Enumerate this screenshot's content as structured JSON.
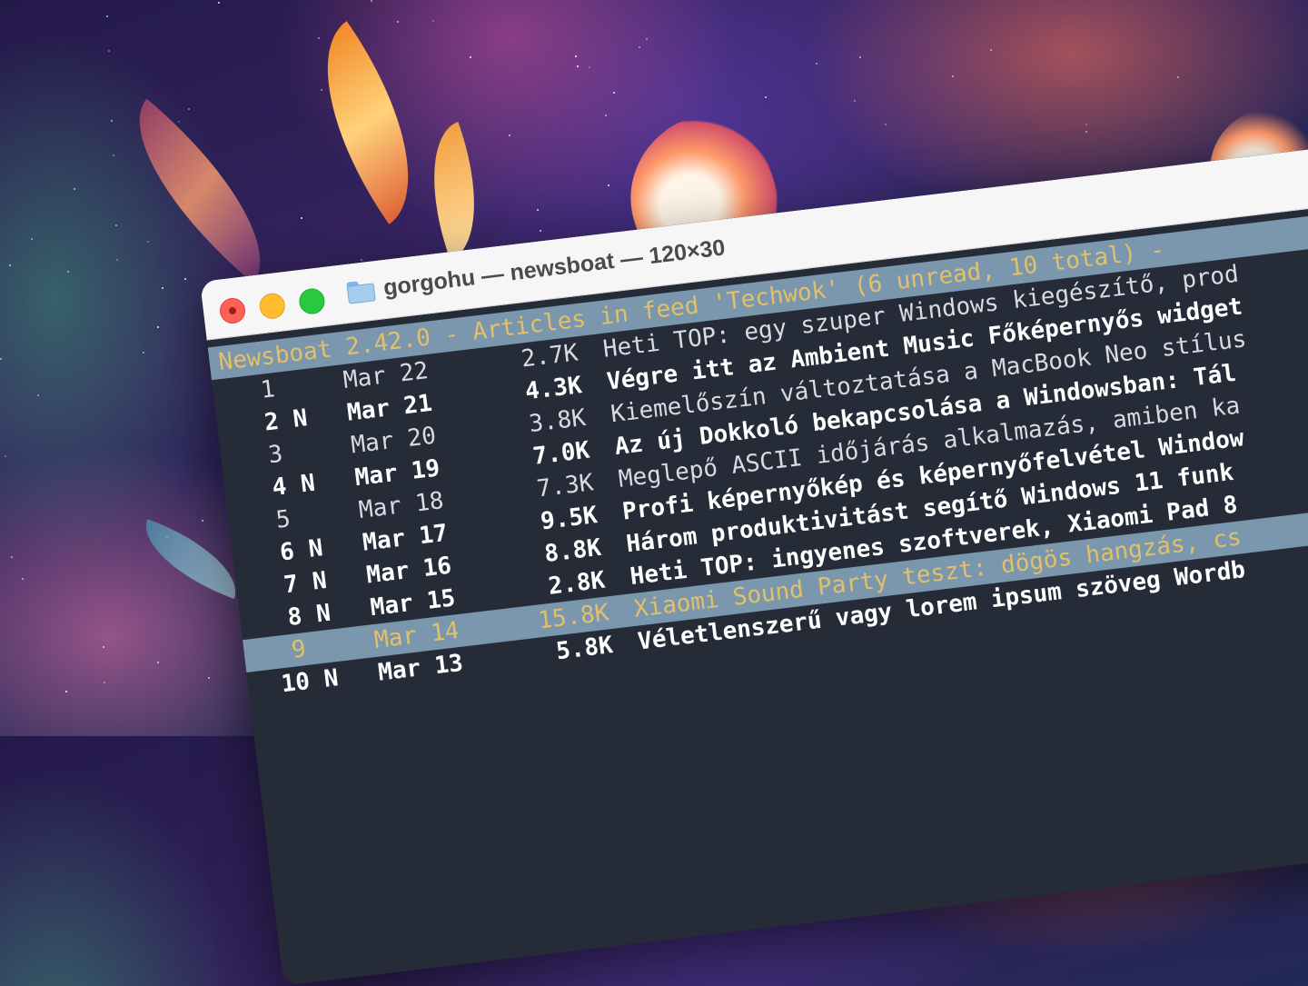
{
  "window": {
    "title": "gorgohu — newsboat — 120×30"
  },
  "header": "Newsboat 2.42.0 - Articles in feed 'Techwok' (6 unread, 10 total) - ",
  "articles": [
    {
      "idx": "1",
      "flag": "",
      "date": "Mar 22",
      "size": "2.7K",
      "title": "Heti TOP: egy szuper Windows kiegészítő, prod",
      "unread": false,
      "selected": false
    },
    {
      "idx": "2",
      "flag": "N",
      "date": "Mar 21",
      "size": "4.3K",
      "title": "Végre itt az Ambient Music Főképernyős widget",
      "unread": true,
      "selected": false
    },
    {
      "idx": "3",
      "flag": "",
      "date": "Mar 20",
      "size": "3.8K",
      "title": "Kiemelőszín változtatása a MacBook Neo stílus",
      "unread": false,
      "selected": false
    },
    {
      "idx": "4",
      "flag": "N",
      "date": "Mar 19",
      "size": "7.0K",
      "title": "Az új Dokkoló bekapcsolása a Windowsban: Tál",
      "unread": true,
      "selected": false
    },
    {
      "idx": "5",
      "flag": "",
      "date": "Mar 18",
      "size": "7.3K",
      "title": "Meglepő ASCII időjárás alkalmazás, amiben ka",
      "unread": false,
      "selected": false
    },
    {
      "idx": "6",
      "flag": "N",
      "date": "Mar 17",
      "size": "9.5K",
      "title": "Profi képernyőkép és képernyőfelvétel Window",
      "unread": true,
      "selected": false
    },
    {
      "idx": "7",
      "flag": "N",
      "date": "Mar 16",
      "size": "8.8K",
      "title": "Három produktivitást segítő Windows 11 funk",
      "unread": true,
      "selected": false
    },
    {
      "idx": "8",
      "flag": "N",
      "date": "Mar 15",
      "size": "2.8K",
      "title": "Heti TOP: ingyenes szoftverek, Xiaomi Pad 8",
      "unread": true,
      "selected": false
    },
    {
      "idx": "9",
      "flag": "",
      "date": "Mar 14",
      "size": "15.8K",
      "title": "Xiaomi Sound Party teszt: dögös hangzás, cs",
      "unread": false,
      "selected": true
    },
    {
      "idx": "10",
      "flag": "N",
      "date": "Mar 13",
      "size": "5.8K",
      "title": "Véletlenszerű vagy lorem ipsum szöveg Wordb",
      "unread": true,
      "selected": false
    }
  ],
  "colors": {
    "header_bg": "#7a97ae",
    "header_fg": "#e2c06a",
    "terminal_bg": "#262b38",
    "text": "#d8dbe2"
  }
}
